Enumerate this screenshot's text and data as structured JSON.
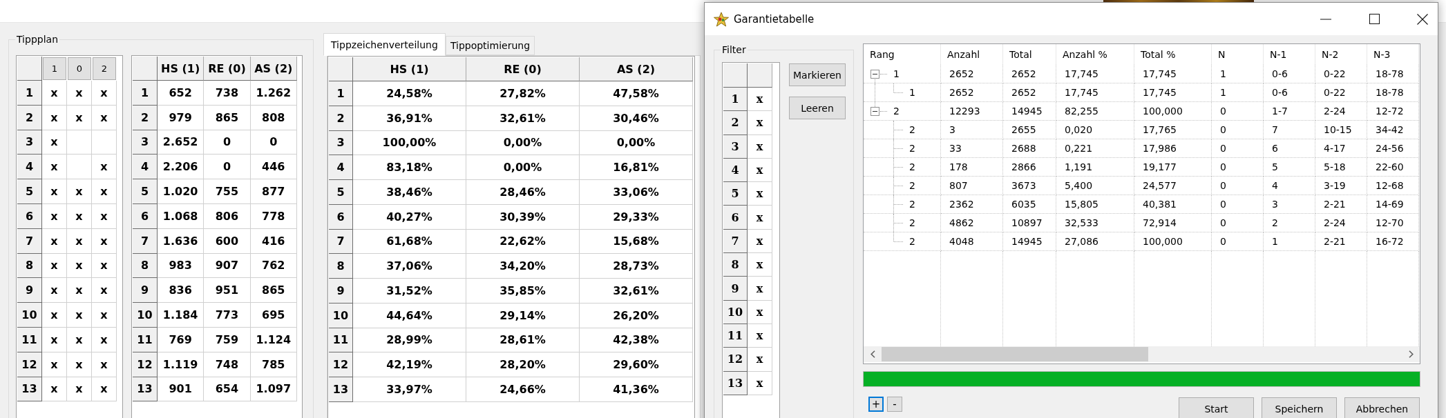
{
  "tippplan": {
    "title": "Tippplan",
    "tip_grid": {
      "columns": [
        "1",
        "0",
        "2"
      ],
      "rows": [
        {
          "label": "1",
          "cells": [
            "x",
            "x",
            "x"
          ]
        },
        {
          "label": "2",
          "cells": [
            "x",
            "x",
            "x"
          ]
        },
        {
          "label": "3",
          "cells": [
            "x",
            null,
            null
          ]
        },
        {
          "label": "4",
          "cells": [
            "x",
            null,
            "x"
          ]
        },
        {
          "label": "5",
          "cells": [
            "x",
            "x",
            "x"
          ]
        },
        {
          "label": "6",
          "cells": [
            "x",
            "x",
            "x"
          ]
        },
        {
          "label": "7",
          "cells": [
            "x",
            "x",
            "x"
          ]
        },
        {
          "label": "8",
          "cells": [
            "x",
            "x",
            "x"
          ]
        },
        {
          "label": "9",
          "cells": [
            "x",
            "x",
            "x"
          ]
        },
        {
          "label": "10",
          "cells": [
            "x",
            "x",
            "x"
          ]
        },
        {
          "label": "11",
          "cells": [
            "x",
            "x",
            "x"
          ]
        },
        {
          "label": "12",
          "cells": [
            "x",
            "x",
            "x"
          ]
        },
        {
          "label": "13",
          "cells": [
            "x",
            "x",
            "x"
          ]
        }
      ]
    },
    "count_table": {
      "columns": [
        "HS (1)",
        "RE (0)",
        "AS (2)"
      ],
      "rows": [
        {
          "label": "1",
          "cells": [
            "652",
            "738",
            "1.262"
          ]
        },
        {
          "label": "2",
          "cells": [
            "979",
            "865",
            "808"
          ]
        },
        {
          "label": "3",
          "cells": [
            "2.652",
            "0",
            "0"
          ]
        },
        {
          "label": "4",
          "cells": [
            "2.206",
            "0",
            "446"
          ]
        },
        {
          "label": "5",
          "cells": [
            "1.020",
            "755",
            "877"
          ]
        },
        {
          "label": "6",
          "cells": [
            "1.068",
            "806",
            "778"
          ]
        },
        {
          "label": "7",
          "cells": [
            "1.636",
            "600",
            "416"
          ]
        },
        {
          "label": "8",
          "cells": [
            "983",
            "907",
            "762"
          ]
        },
        {
          "label": "9",
          "cells": [
            "836",
            "951",
            "865"
          ]
        },
        {
          "label": "10",
          "cells": [
            "1.184",
            "773",
            "695"
          ]
        },
        {
          "label": "11",
          "cells": [
            "769",
            "759",
            "1.124"
          ]
        },
        {
          "label": "12",
          "cells": [
            "1.119",
            "748",
            "785"
          ]
        },
        {
          "label": "13",
          "cells": [
            "901",
            "654",
            "1.097"
          ]
        }
      ]
    }
  },
  "tabs": [
    {
      "label": "Tippzeichenverteilung",
      "selected": true
    },
    {
      "label": "Tippoptimierung",
      "selected": false
    }
  ],
  "distribution_table": {
    "columns": [
      "HS (1)",
      "RE (0)",
      "AS (2)"
    ],
    "rows": [
      {
        "label": "1",
        "cells": [
          "24,58%",
          "27,82%",
          "47,58%"
        ]
      },
      {
        "label": "2",
        "cells": [
          "36,91%",
          "32,61%",
          "30,46%"
        ]
      },
      {
        "label": "3",
        "cells": [
          "100,00%",
          "0,00%",
          "0,00%"
        ]
      },
      {
        "label": "4",
        "cells": [
          "83,18%",
          "0,00%",
          "16,81%"
        ]
      },
      {
        "label": "5",
        "cells": [
          "38,46%",
          "28,46%",
          "33,06%"
        ]
      },
      {
        "label": "6",
        "cells": [
          "40,27%",
          "30,39%",
          "29,33%"
        ]
      },
      {
        "label": "7",
        "cells": [
          "61,68%",
          "22,62%",
          "15,68%"
        ]
      },
      {
        "label": "8",
        "cells": [
          "37,06%",
          "34,20%",
          "28,73%"
        ]
      },
      {
        "label": "9",
        "cells": [
          "31,52%",
          "35,85%",
          "32,61%"
        ]
      },
      {
        "label": "10",
        "cells": [
          "44,64%",
          "29,14%",
          "26,20%"
        ]
      },
      {
        "label": "11",
        "cells": [
          "28,99%",
          "28,61%",
          "42,38%"
        ]
      },
      {
        "label": "12",
        "cells": [
          "42,19%",
          "28,20%",
          "29,60%"
        ]
      },
      {
        "label": "13",
        "cells": [
          "33,97%",
          "24,66%",
          "41,36%"
        ]
      }
    ]
  },
  "dialog": {
    "title": "Garantietabelle",
    "filter": {
      "title": "Filter",
      "rows": [
        {
          "label": "1",
          "cells": [
            "x"
          ]
        },
        {
          "label": "2",
          "cells": [
            "x"
          ]
        },
        {
          "label": "3",
          "cells": [
            "x"
          ]
        },
        {
          "label": "4",
          "cells": [
            "x"
          ]
        },
        {
          "label": "5",
          "cells": [
            "x"
          ]
        },
        {
          "label": "6",
          "cells": [
            "x"
          ]
        },
        {
          "label": "7",
          "cells": [
            "x"
          ]
        },
        {
          "label": "8",
          "cells": [
            "x"
          ]
        },
        {
          "label": "9",
          "cells": [
            "x"
          ]
        },
        {
          "label": "10",
          "cells": [
            "x"
          ]
        },
        {
          "label": "11",
          "cells": [
            "x"
          ]
        },
        {
          "label": "12",
          "cells": [
            "x"
          ]
        },
        {
          "label": "13",
          "cells": [
            "x"
          ]
        }
      ],
      "buttons": [
        "Markieren",
        "Leeren"
      ]
    },
    "tree": {
      "columns": [
        "Rang",
        "Anzahl",
        "Total",
        "Anzahl %",
        "Total %",
        "N",
        "N-1",
        "N-2",
        "N-3"
      ],
      "rows": [
        {
          "expanded": true,
          "cells": [
            "1",
            "2652",
            "2652",
            "17,745",
            "17,745",
            "1",
            "0-6",
            "0-22",
            "18-78"
          ],
          "children": [
            {
              "cells": [
                "1",
                "2652",
                "2652",
                "17,745",
                "17,745",
                "1",
                "0-6",
                "0-22",
                "18-78"
              ]
            }
          ]
        },
        {
          "expanded": true,
          "cells": [
            "2",
            "12293",
            "14945",
            "82,255",
            "100,000",
            "0",
            "1-7",
            "2-24",
            "12-72"
          ],
          "children": [
            {
              "cells": [
                "2",
                "3",
                "2655",
                "0,020",
                "17,765",
                "0",
                "7",
                "10-15",
                "34-42"
              ]
            },
            {
              "cells": [
                "2",
                "33",
                "2688",
                "0,221",
                "17,986",
                "0",
                "6",
                "4-17",
                "24-56"
              ]
            },
            {
              "cells": [
                "2",
                "178",
                "2866",
                "1,191",
                "19,177",
                "0",
                "5",
                "5-18",
                "22-60"
              ]
            },
            {
              "cells": [
                "2",
                "807",
                "3673",
                "5,400",
                "24,577",
                "0",
                "4",
                "3-19",
                "12-68"
              ]
            },
            {
              "cells": [
                "2",
                "2362",
                "6035",
                "15,805",
                "40,381",
                "0",
                "3",
                "2-21",
                "14-69"
              ]
            },
            {
              "cells": [
                "2",
                "4862",
                "10897",
                "32,533",
                "72,914",
                "0",
                "2",
                "2-24",
                "12-70"
              ]
            },
            {
              "cells": [
                "2",
                "4048",
                "14945",
                "27,086",
                "100,000",
                "0",
                "1",
                "2-21",
                "16-72"
              ]
            }
          ]
        }
      ]
    },
    "progress": {
      "level": 1
    },
    "expand_buttons": [
      {
        "label": "+",
        "focused": true
      },
      {
        "label": "-",
        "focused": false
      }
    ],
    "buttons": [
      "Start",
      "Speichern",
      "Abbrechen"
    ]
  }
}
